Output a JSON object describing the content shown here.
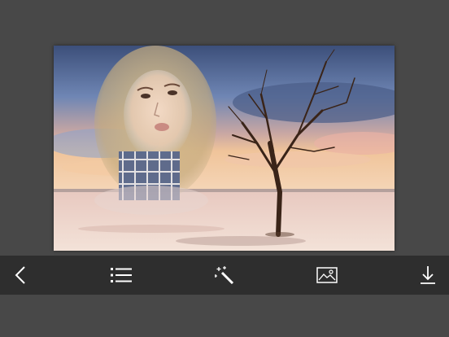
{
  "editor": {
    "photo_description_icon": "photo-frame-composite"
  },
  "toolbar": {
    "items": [
      {
        "icon": "back-chevron-icon"
      },
      {
        "icon": "list-icon"
      },
      {
        "icon": "magic-wand-icon"
      },
      {
        "icon": "image-icon"
      },
      {
        "icon": "download-icon"
      }
    ]
  },
  "colors": {
    "background": "#484848",
    "toolbar": "#2e2e2e",
    "icon": "#ffffff"
  }
}
